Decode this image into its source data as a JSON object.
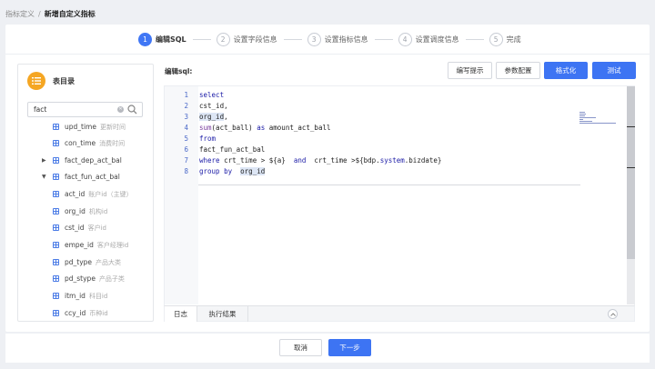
{
  "breadcrumb": {
    "parent": "指标定义",
    "separator": "/",
    "current": "新增自定义指标"
  },
  "steps": [
    {
      "num": "1",
      "label": "编辑SQL",
      "active": true
    },
    {
      "num": "2",
      "label": "设置字段信息",
      "active": false
    },
    {
      "num": "3",
      "label": "设置指标信息",
      "active": false
    },
    {
      "num": "4",
      "label": "设置调度信息",
      "active": false
    },
    {
      "num": "5",
      "label": "完成",
      "active": false
    }
  ],
  "catalog": {
    "title": "表目录",
    "search_value": "fact",
    "rows": [
      {
        "kind": "col",
        "name": "upd_time",
        "desc": "更新时间"
      },
      {
        "kind": "col",
        "name": "con_time",
        "desc": "消费时间"
      },
      {
        "kind": "table",
        "name": "fact_dep_act_bal",
        "desc": "",
        "expanded": false
      },
      {
        "kind": "table",
        "name": "fact_fun_act_bal",
        "desc": "",
        "expanded": true
      },
      {
        "kind": "col",
        "name": "act_id",
        "desc": "账户id（主键）"
      },
      {
        "kind": "col",
        "name": "org_id",
        "desc": "机构id"
      },
      {
        "kind": "col",
        "name": "cst_id",
        "desc": "客户id"
      },
      {
        "kind": "col",
        "name": "empe_id",
        "desc": "客户经理id"
      },
      {
        "kind": "col",
        "name": "pd_type",
        "desc": "产品大类"
      },
      {
        "kind": "col",
        "name": "pd_stype",
        "desc": "产品子类"
      },
      {
        "kind": "col",
        "name": "itm_id",
        "desc": "科目id"
      },
      {
        "kind": "col",
        "name": "ccy_id",
        "desc": "币种id"
      }
    ]
  },
  "editor": {
    "label": "编辑sql:",
    "buttons": {
      "hint": "编写提示",
      "params": "参数配置",
      "format": "格式化",
      "test": "测试"
    },
    "lines": [
      {
        "n": "1",
        "parts": [
          {
            "t": "select",
            "c": "kw"
          }
        ]
      },
      {
        "n": "2",
        "parts": [
          {
            "t": "cst_id,",
            "c": ""
          }
        ]
      },
      {
        "n": "3",
        "parts": [
          {
            "t": "org_id",
            "c": "hl"
          },
          {
            "t": ",",
            "c": ""
          }
        ]
      },
      {
        "n": "4",
        "parts": [
          {
            "t": "sum",
            "c": "fn"
          },
          {
            "t": "(act_ball) ",
            "c": ""
          },
          {
            "t": "as",
            "c": "kw"
          },
          {
            "t": " amount_act_ball",
            "c": ""
          }
        ]
      },
      {
        "n": "5",
        "parts": [
          {
            "t": "from",
            "c": "kw"
          }
        ]
      },
      {
        "n": "6",
        "parts": [
          {
            "t": "fact_fun_act_bal",
            "c": ""
          }
        ]
      },
      {
        "n": "7",
        "parts": [
          {
            "t": "where",
            "c": "kw"
          },
          {
            "t": " crt_time > ${a}  ",
            "c": ""
          },
          {
            "t": "and",
            "c": "kw"
          },
          {
            "t": "  crt_time >${bdp.",
            "c": ""
          },
          {
            "t": "system",
            "c": "kw"
          },
          {
            "t": ".bizdate}",
            "c": ""
          }
        ]
      },
      {
        "n": "8",
        "parts": [
          {
            "t": "group by",
            "c": "kw"
          },
          {
            "t": "  ",
            "c": ""
          },
          {
            "t": "org_id",
            "c": "hl"
          }
        ]
      }
    ]
  },
  "bottom_tabs": {
    "log": "日志",
    "result": "执行结果"
  },
  "footer": {
    "cancel": "取消",
    "next": "下一步"
  },
  "colors": {
    "primary": "#3d74f3",
    "catalog_icon": "#f5a623",
    "step_active": "#4077f5"
  },
  "icons": {
    "catalog": "list-icon",
    "search": "search-icon",
    "clear": "clear-icon",
    "table": "table-icon",
    "collapse": "chevron-up-icon"
  }
}
